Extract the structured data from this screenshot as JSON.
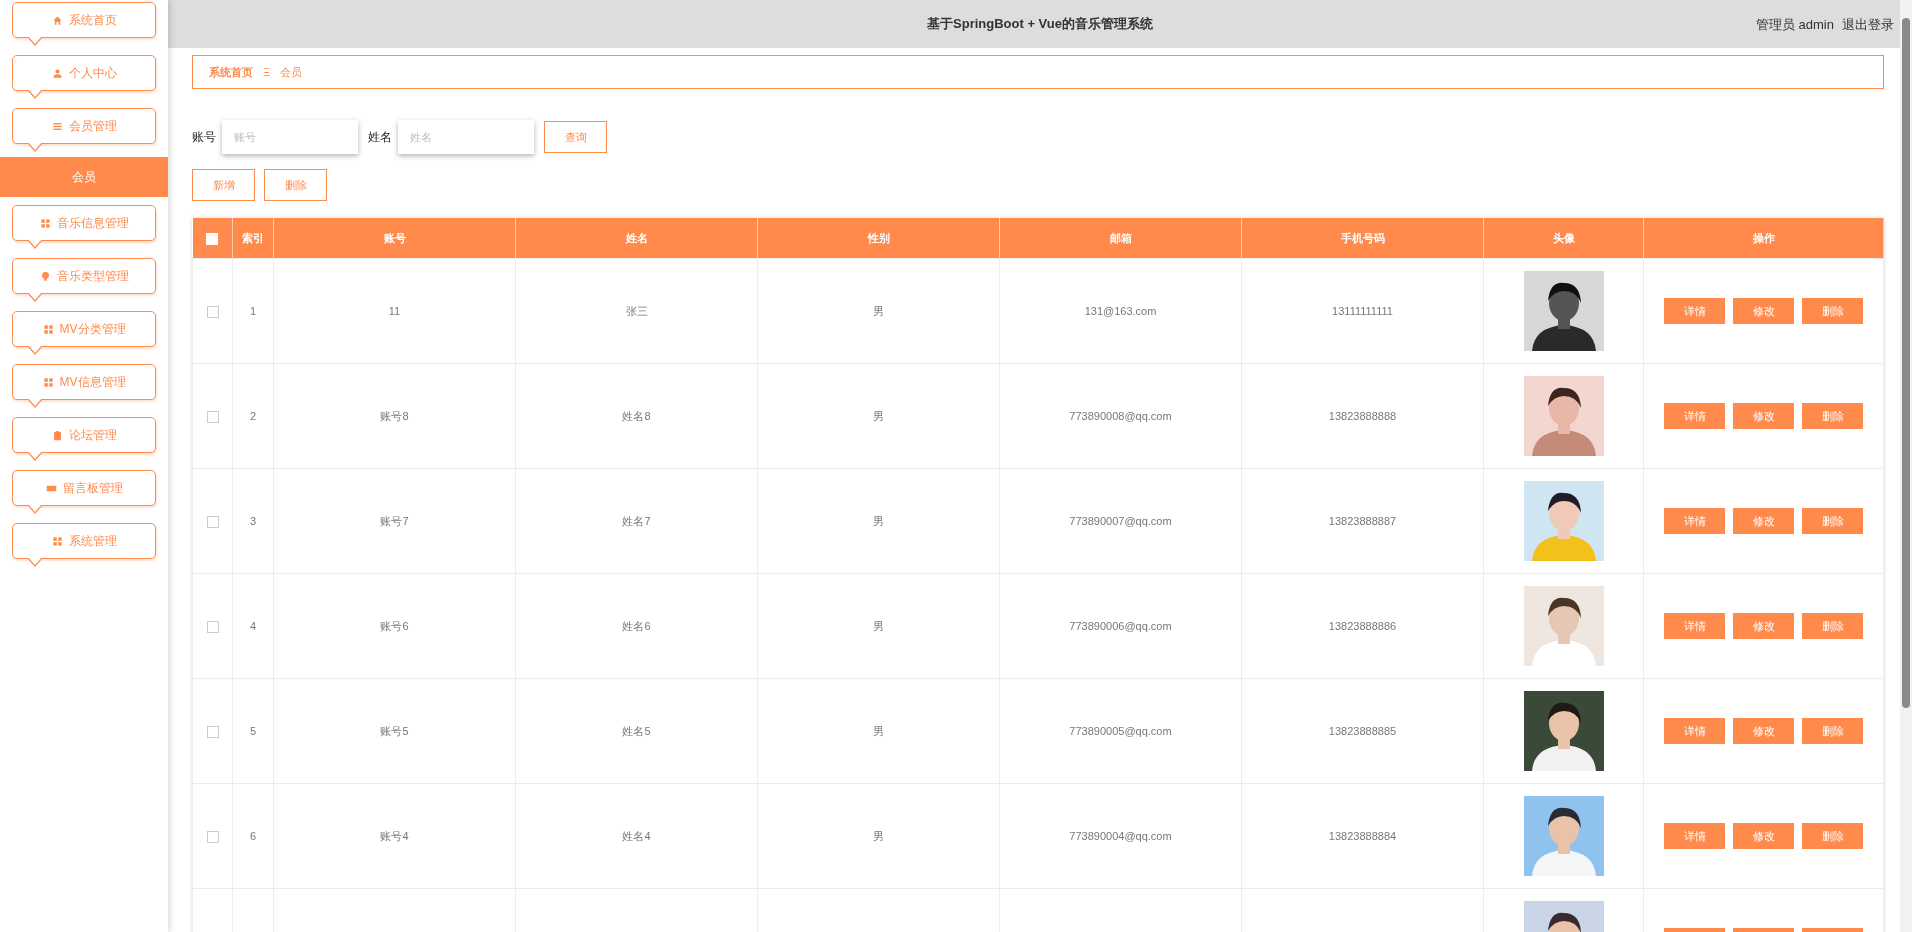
{
  "header": {
    "title": "基于SpringBoot + Vue的音乐管理系统",
    "user": "管理员 admin",
    "logout": "退出登录"
  },
  "sidebar": {
    "items": [
      {
        "label": "系统首页",
        "selected": false
      },
      {
        "label": "个人中心",
        "selected": false
      },
      {
        "label": "会员管理",
        "selected": false,
        "children": [
          {
            "label": "会员",
            "selected": true
          }
        ]
      },
      {
        "label": "音乐信息管理",
        "selected": false
      },
      {
        "label": "音乐类型管理",
        "selected": false
      },
      {
        "label": "MV分类管理",
        "selected": false
      },
      {
        "label": "MV信息管理",
        "selected": false
      },
      {
        "label": "论坛管理",
        "selected": false
      },
      {
        "label": "留言板管理",
        "selected": false
      },
      {
        "label": "系统管理",
        "selected": false
      }
    ]
  },
  "breadcrumb": {
    "items": [
      "系统首页",
      "会员"
    ],
    "separator": "Ξ"
  },
  "filters": [
    {
      "label": "账号",
      "placeholder": "账号"
    },
    {
      "label": "姓名",
      "placeholder": "姓名"
    }
  ],
  "search_button": "查询",
  "actions": [
    "新增",
    "删除"
  ],
  "table": {
    "all_checked": false,
    "columns": [
      "索引",
      "账号",
      "姓名",
      "性别",
      "邮箱",
      "手机号码",
      "头像",
      "操作"
    ],
    "rows": [
      {
        "checked": false,
        "index": "1",
        "account": "11",
        "name": "张三",
        "gender": "男",
        "email": "131@163.com",
        "phone": "13111111111",
        "buttons": [
          "详情",
          "修改",
          "删除"
        ]
      },
      {
        "checked": false,
        "index": "2",
        "account": "账号8",
        "name": "姓名8",
        "gender": "男",
        "email": "773890008@qq.com",
        "phone": "13823888888",
        "buttons": [
          "详情",
          "修改",
          "删除"
        ]
      },
      {
        "checked": false,
        "index": "3",
        "account": "账号7",
        "name": "姓名7",
        "gender": "男",
        "email": "773890007@qq.com",
        "phone": "13823888887",
        "buttons": [
          "详情",
          "修改",
          "删除"
        ]
      },
      {
        "checked": false,
        "index": "4",
        "account": "账号6",
        "name": "姓名6",
        "gender": "男",
        "email": "773890006@qq.com",
        "phone": "13823888886",
        "buttons": [
          "详情",
          "修改",
          "删除"
        ]
      },
      {
        "checked": false,
        "index": "5",
        "account": "账号5",
        "name": "姓名5",
        "gender": "男",
        "email": "773890005@qq.com",
        "phone": "13823888885",
        "buttons": [
          "详情",
          "修改",
          "删除"
        ]
      },
      {
        "checked": false,
        "index": "6",
        "account": "账号4",
        "name": "姓名4",
        "gender": "男",
        "email": "773890004@qq.com",
        "phone": "13823888884",
        "buttons": [
          "详情",
          "修改",
          "删除"
        ]
      }
    ]
  }
}
